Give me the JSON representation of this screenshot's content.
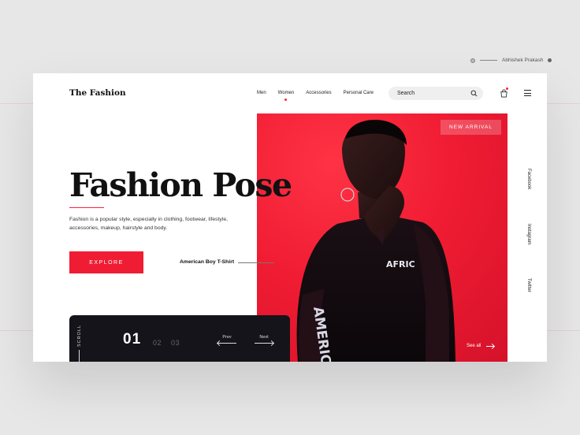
{
  "author": {
    "name": "Abhishek Prakash"
  },
  "header": {
    "logo": "The Fashion",
    "nav": [
      "Men",
      "Women",
      "Accessories",
      "Personal Care"
    ],
    "active_nav": "Women",
    "search_placeholder": "Search"
  },
  "hero": {
    "title": "Fashion Pose",
    "description": "Fashion is a popular style, especially in clothing, footwear, lifestyle, accessories, makeup, hairstyle and body.",
    "cta": "EXPLORE",
    "product_label": "American Boy T-Shirt",
    "badge": "NEW ARRIVAL",
    "see_all": "See all",
    "image_text_chest": "AFRIC",
    "image_text_sleeve": "AMERICAN BOY"
  },
  "social": [
    "Facebook",
    "Instagram",
    "Twitter"
  ],
  "slider": {
    "scroll_label": "SCROLL",
    "current": "01",
    "others": [
      "02",
      "03"
    ],
    "prev": "Prev",
    "next": "Next"
  },
  "colors": {
    "accent": "#f01c33",
    "dark": "#15141a"
  }
}
